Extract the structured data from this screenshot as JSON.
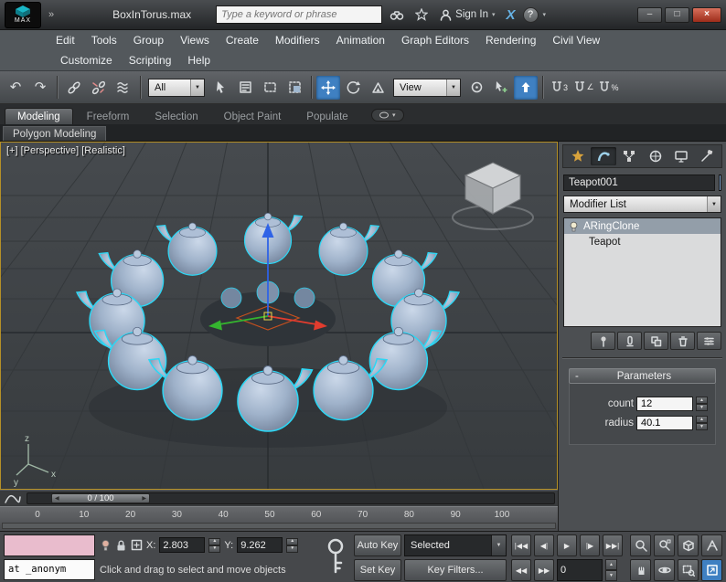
{
  "window": {
    "brand": "MAX",
    "overflow": "»",
    "title": "BoxInTorus.max",
    "search_placeholder": "Type a keyword or phrase",
    "sign_in": "Sign In",
    "exchange_label": "X",
    "help_label": "?",
    "minimize": "–",
    "maximize": "□",
    "close": "×"
  },
  "menu": {
    "row1": [
      "Edit",
      "Tools",
      "Group",
      "Views",
      "Create",
      "Modifiers",
      "Animation",
      "Graph Editors",
      "Rendering",
      "Civil View"
    ],
    "row2": [
      "Customize",
      "Scripting",
      "Help"
    ]
  },
  "toolbar": {
    "undo": "↶",
    "redo": "↷",
    "filter_value": "All",
    "coordsys_value": "View",
    "snap_3d": "3",
    "snap_angle": "∠",
    "snap_percent": "%"
  },
  "ribbon": {
    "tabs": [
      "Modeling",
      "Freeform",
      "Selection",
      "Object Paint",
      "Populate"
    ],
    "panel_tab": "Polygon Modeling"
  },
  "viewport": {
    "label": "[+] [Perspective] [Realistic]"
  },
  "timeline": {
    "slider_label": "0 / 100",
    "prev": "◀",
    "next": "▶",
    "ticks": [
      "0",
      "10",
      "20",
      "30",
      "40",
      "50",
      "60",
      "70",
      "80",
      "90",
      "100"
    ]
  },
  "command_panel": {
    "object_name": "Teapot001",
    "modifier_list_label": "Modifier List",
    "stack": {
      "item1": "ARingClone",
      "item2": "Teapot"
    },
    "parameters": {
      "collapse": "-",
      "title": "Parameters",
      "count_label": "count",
      "count_value": "12",
      "radius_label": "radius",
      "radius_value": "40.1"
    }
  },
  "status": {
    "listener_text": "at _anonym",
    "prompt": "Click and drag to select and move objects",
    "x_label": "X:",
    "x_value": "2.803",
    "y_label": "Y:",
    "y_value": "9.262",
    "auto_key": "Auto Key",
    "set_key": "Set Key",
    "selected_value": "Selected",
    "key_filters": "Key Filters...",
    "time_value": "0",
    "pb_start": "|◀◀",
    "pb_prev": "◀|",
    "pb_play": "▶",
    "pb_next": "|▶",
    "pb_end": "▶▶|",
    "pb_prev_key": "◀◀",
    "pb_next_key": "▶▶"
  },
  "glyphs": {
    "spin_up": "▲",
    "spin_down": "▼",
    "combo_arrow": "▼",
    "caret": "▾"
  }
}
